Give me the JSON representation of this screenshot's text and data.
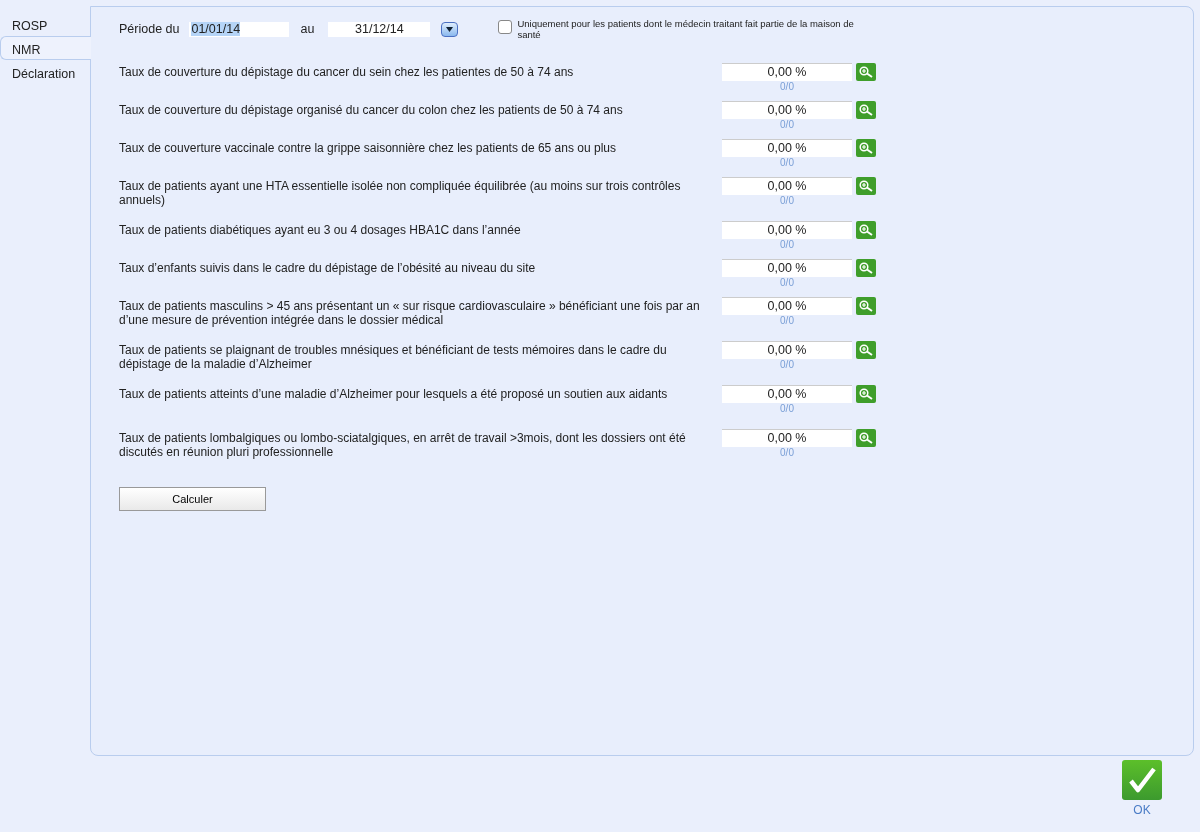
{
  "tabs": [
    {
      "label": "ROSP",
      "selected": false
    },
    {
      "label": "NMR",
      "selected": true
    },
    {
      "label": "Déclaration",
      "selected": false
    }
  ],
  "period": {
    "label_from": "Période du",
    "date_from": "01/01/14",
    "date_from_highlighted": true,
    "label_to": "au",
    "date_to": "31/12/14"
  },
  "filter_checkbox": {
    "label": "Uniquement pour les patients dont le médecin traitant fait partie de la maison de santé",
    "checked": false
  },
  "indicators": [
    {
      "label": "Taux de couverture du dépistage du cancer du sein chez les patientes de 50 à 74 ans",
      "value": "0,00 %",
      "count": "0/0"
    },
    {
      "label": "Taux de couverture du dépistage organisé du cancer du colon chez les patients de 50 à 74 ans",
      "value": "0,00 %",
      "count": "0/0"
    },
    {
      "label": "Taux de couverture vaccinale contre la grippe saisonnière chez les patients de 65 ans ou plus",
      "value": "0,00 %",
      "count": "0/0"
    },
    {
      "label": "Taux de patients ayant une HTA essentielle isolée non compliquée équilibrée (au moins sur trois contrôles annuels)",
      "value": "0,00 %",
      "count": "0/0"
    },
    {
      "label": "Taux de patients diabétiques ayant eu 3 ou 4 dosages HBA1C dans l’année",
      "value": "0,00 %",
      "count": "0/0"
    },
    {
      "label": "Taux d’enfants suivis dans le cadre du dépistage de l’obésité au niveau du site",
      "value": "0,00 %",
      "count": "0/0"
    },
    {
      "label": "Taux de patients masculins > 45 ans présentant un « sur risque cardiovasculaire » bénéficiant une fois par an d’une mesure de prévention intégrée dans le dossier médical",
      "value": "0,00 %",
      "count": "0/0"
    },
    {
      "label": "Taux de patients se plaignant de troubles mnésiques et bénéficiant de tests mémoires dans le cadre du dépistage de la maladie d’Alzheimer",
      "value": "0,00 %",
      "count": "0/0"
    },
    {
      "label": "Taux de patients atteints d’une maladie d’Alzheimer pour lesquels a été proposé un soutien aux aidants",
      "value": "0,00 %",
      "count": "0/0"
    },
    {
      "label": "Taux de patients lombalgiques ou lombo-sciatalgiques, en arrêt de travail >3mois, dont les dossiers ont été discutés en réunion pluri professionnelle",
      "value": "0,00 %",
      "count": "0/0"
    }
  ],
  "calculate_button": "Calculer",
  "ok_button": "OK"
}
